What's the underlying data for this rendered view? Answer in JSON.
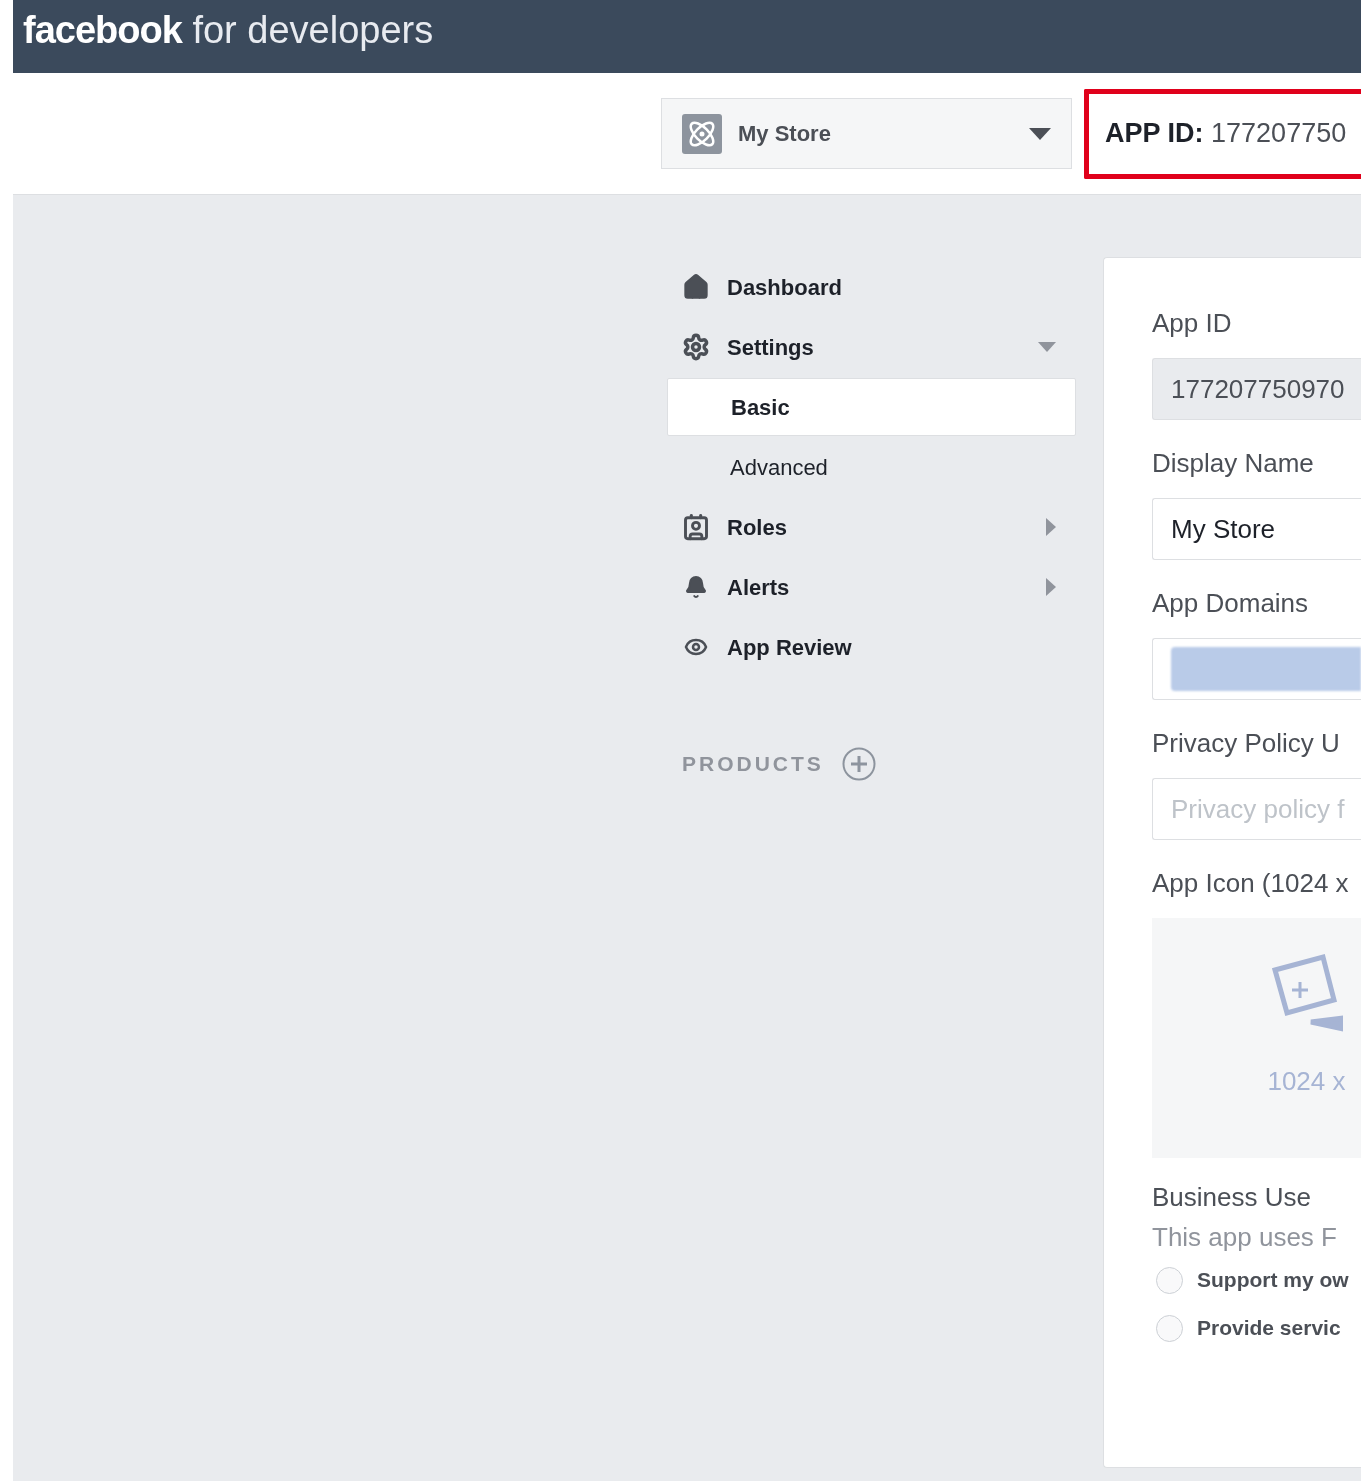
{
  "header": {
    "logo_bold": "facebook",
    "logo_rest": "for developers"
  },
  "app_selector": {
    "name": "My Store"
  },
  "app_id_banner": {
    "label": "APP ID:",
    "value": "177207750"
  },
  "sidebar": {
    "items": [
      {
        "label": "Dashboard"
      },
      {
        "label": "Settings",
        "expanded": true,
        "children": [
          {
            "label": "Basic",
            "selected": true
          },
          {
            "label": "Advanced",
            "selected": false
          }
        ]
      },
      {
        "label": "Roles",
        "expanded": false
      },
      {
        "label": "Alerts",
        "expanded": false
      },
      {
        "label": "App Review"
      }
    ],
    "products": {
      "label": "PRODUCTS"
    }
  },
  "form": {
    "fields": [
      {
        "kind": "readonly",
        "label": "App ID",
        "value": "177207750970"
      },
      {
        "kind": "text",
        "label": "Display Name",
        "value": "My Store"
      },
      {
        "kind": "tags",
        "label": "App Domains"
      },
      {
        "kind": "text",
        "label": "Privacy Policy U",
        "placeholder": "Privacy policy f"
      },
      {
        "kind": "icon_upload",
        "label": "App Icon (1024 x",
        "hint": "1024 x"
      }
    ],
    "business_use": {
      "label": "Business Use",
      "description": "This app uses F",
      "options": [
        {
          "label": "Support my ow",
          "selected": false
        },
        {
          "label": "Provide servic",
          "selected": false
        }
      ]
    }
  }
}
